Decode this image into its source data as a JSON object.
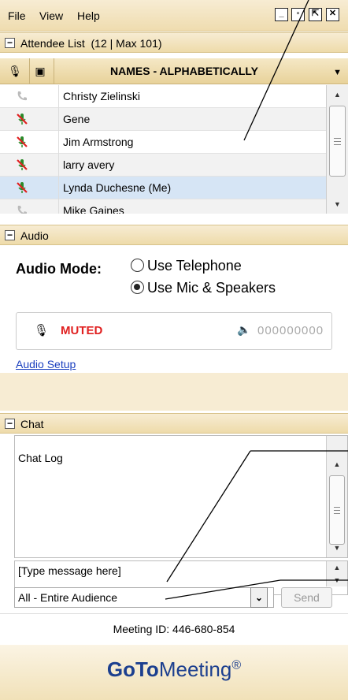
{
  "menubar": {
    "items": [
      "File",
      "View",
      "Help"
    ],
    "window_buttons": [
      "minimize",
      "restore",
      "popout",
      "close"
    ]
  },
  "attendee": {
    "section_title": "Attendee List",
    "count_text": "(12 | Max 101)",
    "column_header": "NAMES - ALPHABETICALLY",
    "rows": [
      {
        "name": "Christy Zielinski",
        "mic": "phone-icon"
      },
      {
        "name": "Gene",
        "mic": "mic-muted-icon"
      },
      {
        "name": "Jim Armstrong",
        "mic": "mic-muted-icon"
      },
      {
        "name": "larry avery",
        "mic": "mic-muted-icon"
      },
      {
        "name": "Lynda Duchesne (Me)",
        "mic": "mic-muted-icon"
      },
      {
        "name": "Mike Gaines",
        "mic": "phone-icon"
      }
    ]
  },
  "audio": {
    "section_title": "Audio",
    "mode_label": "Audio Mode:",
    "option_phone": "Use Telephone",
    "option_mic": "Use Mic & Speakers",
    "selected": "mic",
    "status": "MUTED",
    "level": "000000000",
    "setup_link": "Audio Setup"
  },
  "chat": {
    "section_title": "Chat",
    "log_text": "Chat Log",
    "input_placeholder": "[Type message here]",
    "recipient": "All - Entire Audience",
    "send_label": "Send"
  },
  "footer": {
    "meeting_id": "Meeting ID: 446-680-854",
    "brand_bold": "GoTo",
    "brand_rest": "Meeting",
    "brand_mark": "®"
  },
  "colors": {
    "accent": "#1c3f8f",
    "muted": "#e02020",
    "header_bg": "#efdcaf"
  }
}
